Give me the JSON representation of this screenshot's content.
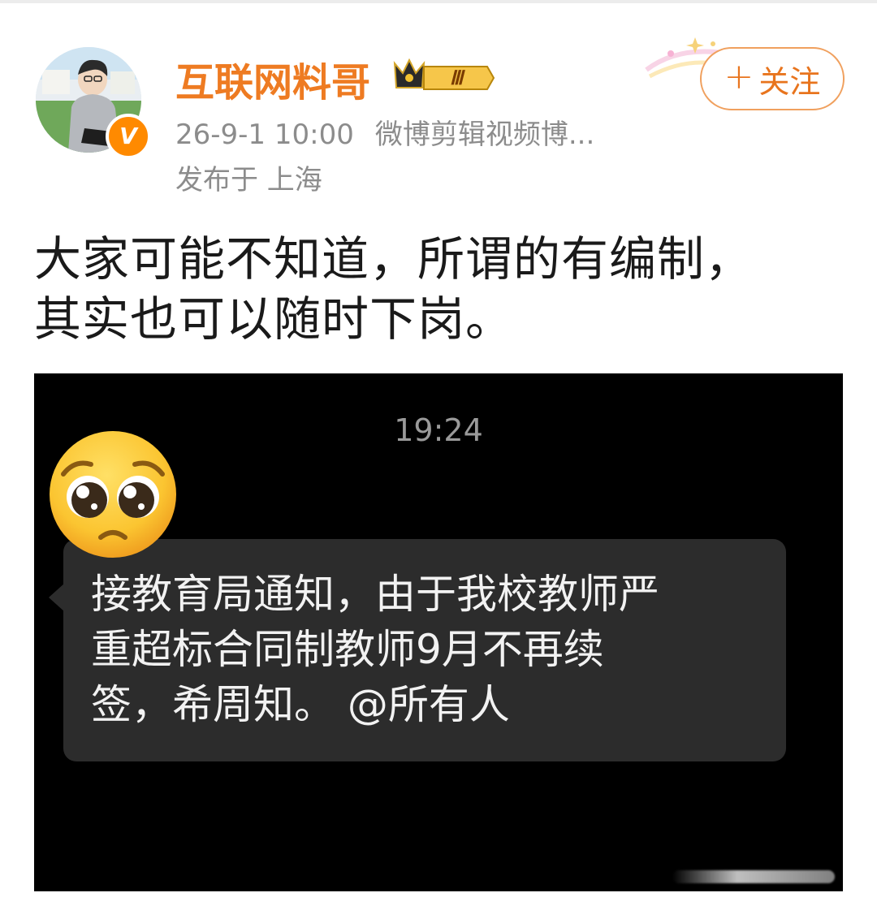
{
  "post": {
    "author": {
      "name": "互联网料哥",
      "level_badge": "Ⅲ",
      "verified_mark": "V"
    },
    "meta": {
      "time": "26-9-1 10:00",
      "source": "微博剪辑视频博...",
      "location": "发布于 上海"
    },
    "follow": {
      "plus": "+",
      "label": "关注"
    },
    "text_lines": [
      "大家可能不知道，所谓的有编制，",
      "其实也可以随时下岗。"
    ]
  },
  "image": {
    "time": "19:24",
    "message_lines": [
      "接教育局通知，由于我校教师严",
      "重超标合同制教师9月不再续",
      "签，希周知。 @所有人"
    ],
    "emoji": "pleading-face",
    "colors": {
      "background": "#000000",
      "bubble": "#2c2c2c"
    }
  },
  "colors": {
    "accent": "#ee7b22",
    "meta_text": "#8c8c8c",
    "body_text": "#1a1a1a"
  }
}
